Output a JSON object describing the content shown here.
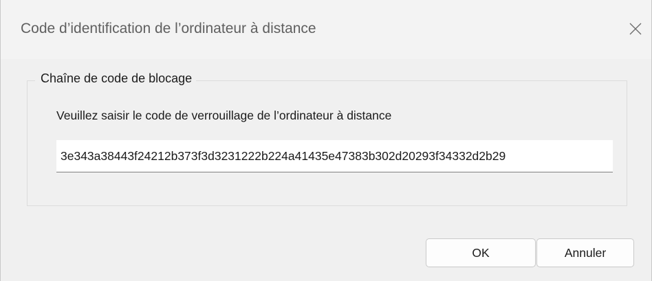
{
  "window": {
    "title": "Code d’identification de l’ordinateur à distance",
    "close_icon": "close-icon"
  },
  "group": {
    "legend": "Chaîne de code de blocage",
    "prompt": "Veuillez saisir le code de verrouillage de l’ordinateur à distance",
    "code_value": "3e343a38443f24212b373f3d3231222b224a41435e47383b302d20293f34332d2b29"
  },
  "buttons": {
    "ok_label": "OK",
    "cancel_label": "Annuler"
  }
}
